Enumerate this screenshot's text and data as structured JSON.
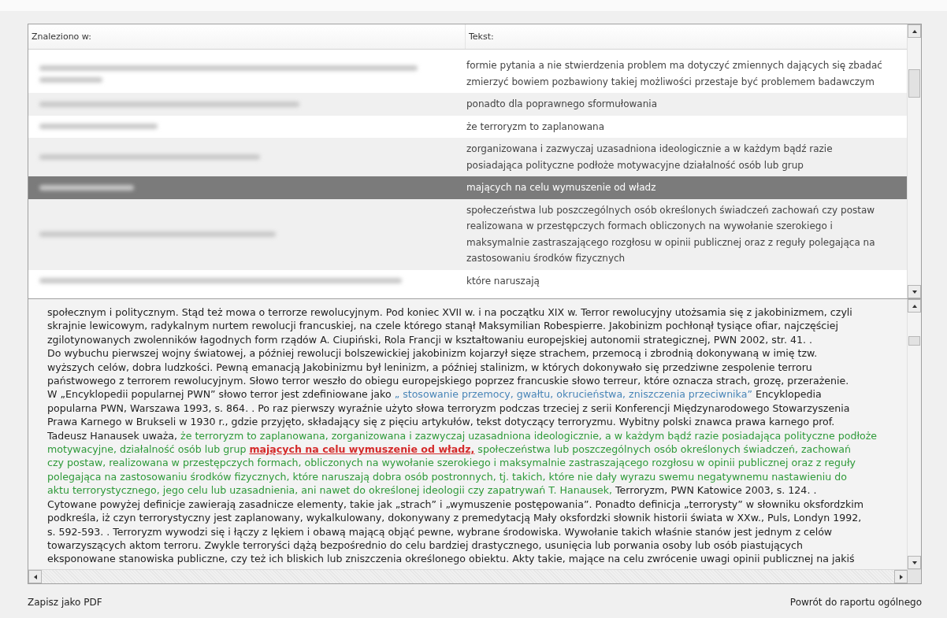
{
  "results_table": {
    "columns": [
      "Znaleziono w:",
      "Tekst:"
    ],
    "rows": [
      {
        "text": "formie pytania a nie stwierdzenia problem ma dotyczyć zmiennych dających się zbadać zmierzyć bowiem pozbawiony takiej możliwości przestaje być problemem badawczym",
        "selected": false
      },
      {
        "text": "ponadto dla poprawnego sformułowania",
        "selected": false
      },
      {
        "text": "że terroryzm to zaplanowana",
        "selected": false
      },
      {
        "text": "zorganizowana i zazwyczaj uzasadniona ideologicznie a w każdym bądź razie posiadająca polityczne podłoże motywacyjne działalność osób lub grup",
        "selected": false
      },
      {
        "text": "mających na celu wymuszenie od władz",
        "selected": true
      },
      {
        "text": "społeczeństwa lub poszczególnych osób określonych świadczeń zachowań czy postaw realizowana w przestępczych formach obliczonych na wywołanie szerokiego i maksymalnie zastraszającego rozgłosu w opinii publicznej oraz z reguły polegająca na zastosowaniu środków fizycznych",
        "selected": false
      },
      {
        "text": "które naruszają",
        "selected": false
      }
    ]
  },
  "document_text": {
    "lines": [
      [
        {
          "kind": "plain",
          "text": "społecznym i politycznym. Stąd też mowa o terrorze rewolucyjnym. Pod koniec XVII w. i na początku XIX w. Terror rewolucyjny utożsamia się z jakobinizmem, czyli"
        }
      ],
      [
        {
          "kind": "plain",
          "text": "skrajnie lewicowym, radykalnym nurtem rewolucji francuskiej, na czele którego stanął Maksymilian Robespierre. Jakobinizm pochłonął tysiące ofiar, najczęściej"
        }
      ],
      [
        {
          "kind": "plain",
          "text": "zgilotynowanych zwolenników łagodnych form rządów A. Ciupiński, Rola Francji w kształtowaniu europejskiej autonomii strategicznej, PWN 2002, str. 41. ."
        }
      ],
      [
        {
          "kind": "plain",
          "text": "Do wybuchu pierwszej wojny światowej, a później rewolucji bolszewickiej jakobinizm kojarzył sięze strachem, przemocą i zbrodnią dokonywaną w imię tzw."
        }
      ],
      [
        {
          "kind": "plain",
          "text": "wyższych celów, dobra ludzkości. Pewną emanacją Jakobinizmu był leninizm, a później stalinizm, w których dokonywało się przedziwne zespolenie terroru"
        }
      ],
      [
        {
          "kind": "plain",
          "text": "państwowego z terrorem rewolucyjnym. Słowo terror weszło do obiegu europejskiego poprzez francuskie słowo terreur, które oznacza strach, grozę, przerażenie."
        }
      ],
      [
        {
          "kind": "plain",
          "text": "W „Encyklopedii popularnej PWN” słowo terror jest zdefiniowane jako "
        },
        {
          "kind": "quote",
          "text": "„ stosowanie przemocy, gwałtu, okrucieństwa, zniszczenia przeciwnika”"
        },
        {
          "kind": "plain",
          "text": " Encyklopedia"
        }
      ],
      [
        {
          "kind": "plain",
          "text": "popularna PWN, Warszawa 1993, s. 864. . Po raz pierwszy wyraźnie użyto słowa terroryzm podczas trzeciej z serii Konferencji Międzynarodowego Stowarzyszenia"
        }
      ],
      [
        {
          "kind": "plain",
          "text": "Prawa Karnego w Brukseli w 1930 r., gdzie przyjęto, składający się z pięciu artykułów, tekst dotyczący terroryzmu. Wybitny polski znawca prawa karnego prof."
        }
      ],
      [
        {
          "kind": "plain",
          "text": "Tadeusz Hanausek uważa, "
        },
        {
          "kind": "cited",
          "text": "że terroryzm to zaplanowana, zorganizowana i zazwyczaj uzasadniona ideologicznie, a w każdym bądź razie posiadająca polityczne podłoże"
        }
      ],
      [
        {
          "kind": "cited",
          "text": "motywacyjne, działalność osób lub grup "
        },
        {
          "kind": "match",
          "text": "mających na celu wymuszenie od władz,"
        },
        {
          "kind": "cited",
          "text": " społeczeństwa lub poszczególnych osób określonych świadczeń, zachowań"
        }
      ],
      [
        {
          "kind": "cited",
          "text": "czy postaw, realizowana w przestępczych formach, obliczonych na wywołanie szerokiego i maksymalnie zastraszającego rozgłosu w opinii publicznej oraz z reguły"
        }
      ],
      [
        {
          "kind": "cited",
          "text": "polegająca na zastosowaniu środków fizycznych, które naruszają dobra osób postronnych, tj. takich, które nie dały wyrazu swemu negatywnemu nastawieniu do"
        }
      ],
      [
        {
          "kind": "cited",
          "text": "aktu terrorystycznego, jego celu lub uzasadnienia, ani nawet do określonej ideologii czy zapatrywań T. Hanausek,"
        },
        {
          "kind": "plain",
          "text": " Terroryzm, PWN Katowice 2003, s. 124. ."
        }
      ],
      [
        {
          "kind": "plain",
          "text": "Cytowane powyżej definicje zawierają zasadnicze elementy, takie jak „strach” i „wymuszenie postępowania”. Ponadto definicja „terrorysty” w słowniku oksfordzkim"
        }
      ],
      [
        {
          "kind": "plain",
          "text": "podkreśla, iż czyn terrorystyczny jest zaplanowany, wykalkulowany, dokonywany z premedytacją Mały oksfordzki słownik historii świata w XXw., Puls, Londyn 1992,"
        }
      ],
      [
        {
          "kind": "plain",
          "text": "s. 592-593. . Terroryzm wywodzi się i łączy z lękiem i obawą mającą objąć pewne, wybrane środowiska. Wywołanie takich właśnie stanów jest jednym z celów"
        }
      ],
      [
        {
          "kind": "plain",
          "text": "towarzyszących aktom terroru. Zwykle terroryści dążą bezpośrednio do celu bardziej drastycznego, usunięcia lub porwania osoby lub osób piastujących"
        }
      ],
      [
        {
          "kind": "plain",
          "text": "eksponowane stanowiska publiczne, czy też ich bliskich lub zniszczenia określonego obiektu. Akty takie, mające na celu zwrócenie uwagi opinii publicznej na jakiś"
        }
      ]
    ]
  },
  "footer": {
    "save_link": "Zapisz jako PDF",
    "back_link": "Powrót do raportu ogólnego"
  }
}
